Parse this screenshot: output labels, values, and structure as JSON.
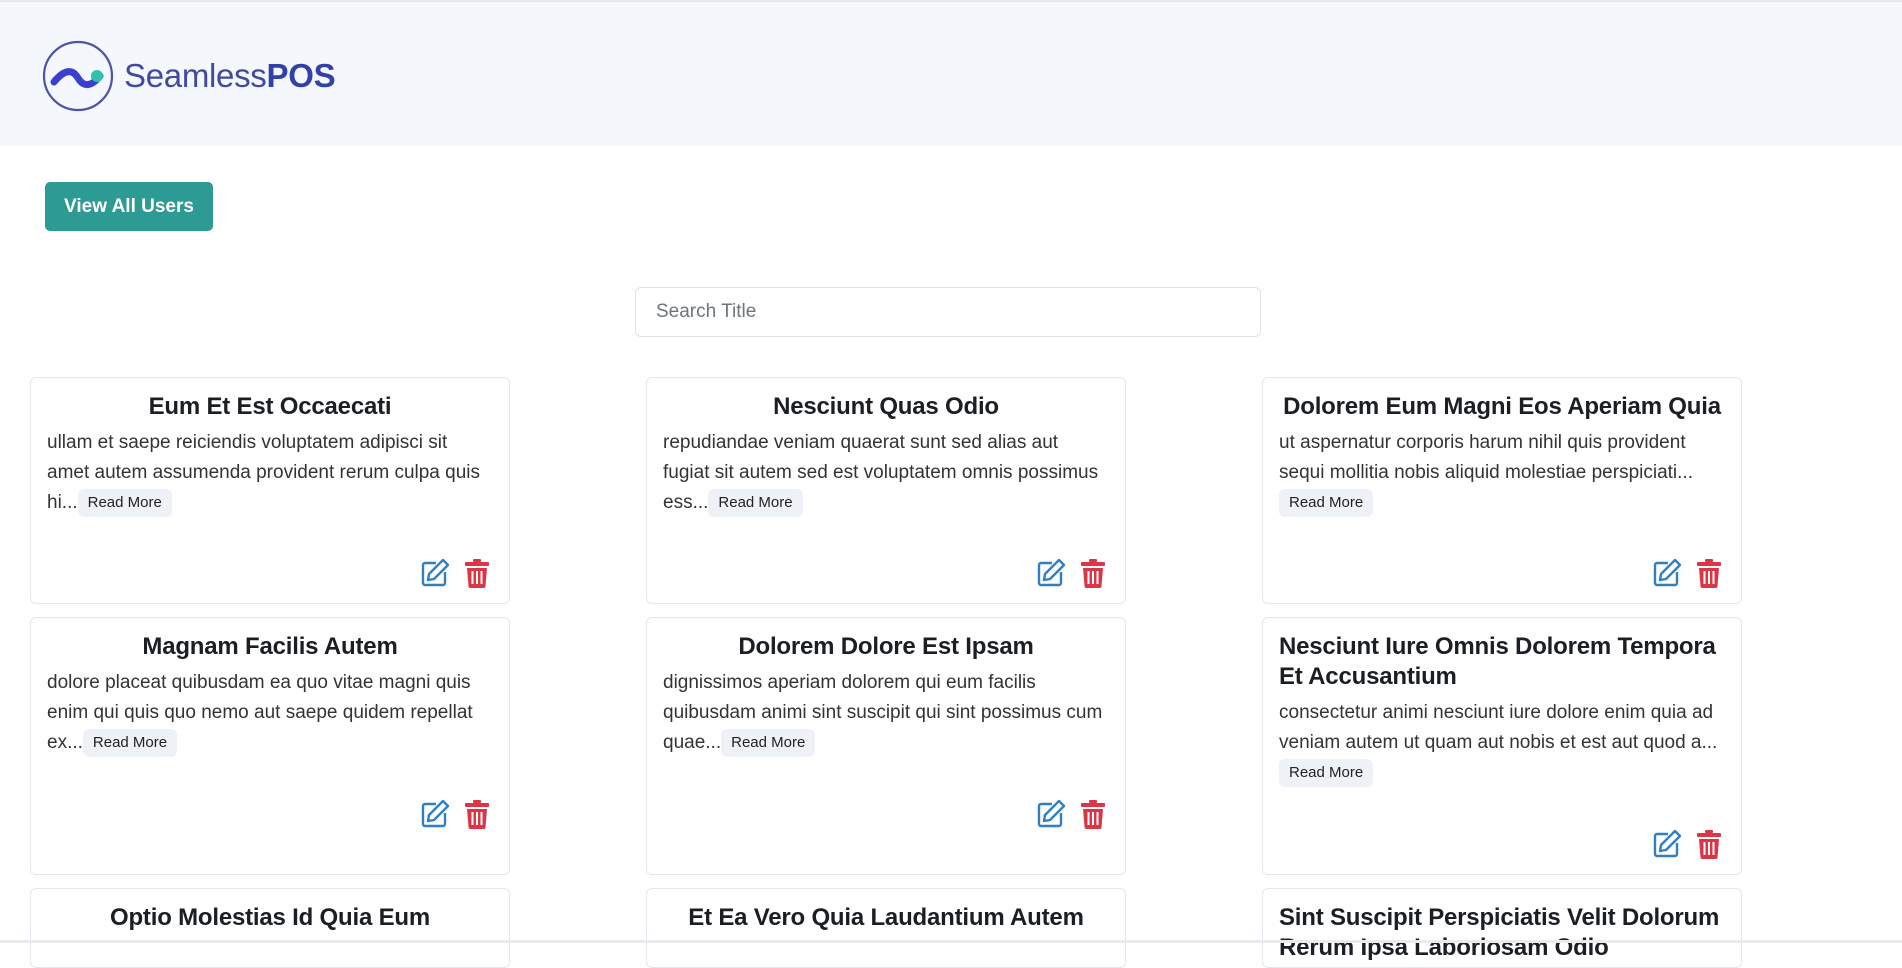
{
  "brand": {
    "name_light": "Seamless",
    "name_bold": "POS"
  },
  "toolbar": {
    "view_users_label": "View All Users"
  },
  "search": {
    "placeholder": "Search Title"
  },
  "colors": {
    "primary_button": "#2e9a94",
    "edit_icon": "#2f7fc1",
    "delete_icon": "#dc3545",
    "brand": "#3f4aa0"
  },
  "icons": {
    "edit": "edit-icon",
    "delete": "trash-icon"
  },
  "cards": [
    {
      "title": "Eum Et Est Occaecati",
      "body": "ullam et saepe reiciendis voluptatem adipisci sit amet autem assumenda provident rerum culpa quis hi...",
      "read_more": "Read More"
    },
    {
      "title": "Nesciunt Quas Odio",
      "body": "repudiandae veniam quaerat sunt sed alias aut fugiat sit autem sed est voluptatem omnis possimus ess...",
      "read_more": "Read More"
    },
    {
      "title": "Dolorem Eum Magni Eos Aperiam Quia",
      "body": "ut aspernatur corporis harum nihil quis provident sequi mollitia nobis aliquid molestiae perspiciati...",
      "read_more": "Read More"
    },
    {
      "title": "Magnam Facilis Autem",
      "body": "dolore placeat quibusdam ea quo vitae magni quis enim qui quis quo nemo aut saepe quidem repellat ex...",
      "read_more": "Read More"
    },
    {
      "title": "Dolorem Dolore Est Ipsam",
      "body": "dignissimos aperiam dolorem qui eum facilis quibusdam animi sint suscipit qui sint possimus cum quae...",
      "read_more": "Read More"
    },
    {
      "title": "Nesciunt Iure Omnis Dolorem Tempora Et Accusantium",
      "body": "consectetur animi nesciunt iure dolore enim quia ad veniam autem ut quam aut nobis et est aut quod a...",
      "read_more": "Read More"
    },
    {
      "title": "Optio Molestias Id Quia Eum"
    },
    {
      "title": "Et Ea Vero Quia Laudantium Autem"
    },
    {
      "title": "Sint Suscipit Perspiciatis Velit Dolorum Rerum Ipsa Laboriosam Odio"
    }
  ]
}
